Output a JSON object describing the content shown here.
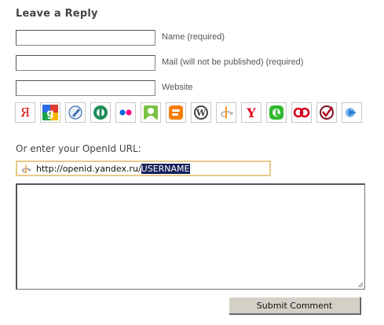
{
  "form": {
    "title": "Leave a Reply",
    "fields": [
      {
        "label": "Name (required)",
        "value": ""
      },
      {
        "label": "Mail (will not be published) (required)",
        "value": ""
      },
      {
        "label": "Website",
        "value": ""
      }
    ],
    "providers": [
      {
        "name": "yandex-icon",
        "glyph": "Я",
        "color": "#e00000"
      },
      {
        "name": "google-icon",
        "glyph": "",
        "color": "#4a8af4"
      },
      {
        "name": "livejournal-icon",
        "glyph": "",
        "color": "#3a6fb0"
      },
      {
        "name": "openid-green-icon",
        "glyph": "",
        "color": "#1e8c5a"
      },
      {
        "name": "flickr-icon",
        "glyph": "",
        "color": "#0063dc"
      },
      {
        "name": "myopenid-icon",
        "glyph": "",
        "color": "#7ac142"
      },
      {
        "name": "blogger-icon",
        "glyph": "",
        "color": "#f57d00"
      },
      {
        "name": "wordpress-icon",
        "glyph": "W",
        "color": "#464646"
      },
      {
        "name": "openid-icon",
        "glyph": "",
        "color": "#f7931e"
      },
      {
        "name": "yahoo-icon",
        "glyph": "Y",
        "color": "#e0001b"
      },
      {
        "name": "technorati-icon",
        "glyph": "",
        "color": "#2eb82e"
      },
      {
        "name": "aol-icon",
        "glyph": "",
        "color": "#d6001c"
      },
      {
        "name": "verisign-icon",
        "glyph": "",
        "color": "#b00020"
      },
      {
        "name": "claimid-icon",
        "glyph": "",
        "color": "#2b7bd1"
      }
    ],
    "openid": {
      "label": "Or enter your OpenId URL:",
      "url_prefix": "http://openid.yandex.ru/",
      "url_selected": "USERNAME"
    },
    "comment_value": "",
    "submit_label": "Submit Comment"
  }
}
